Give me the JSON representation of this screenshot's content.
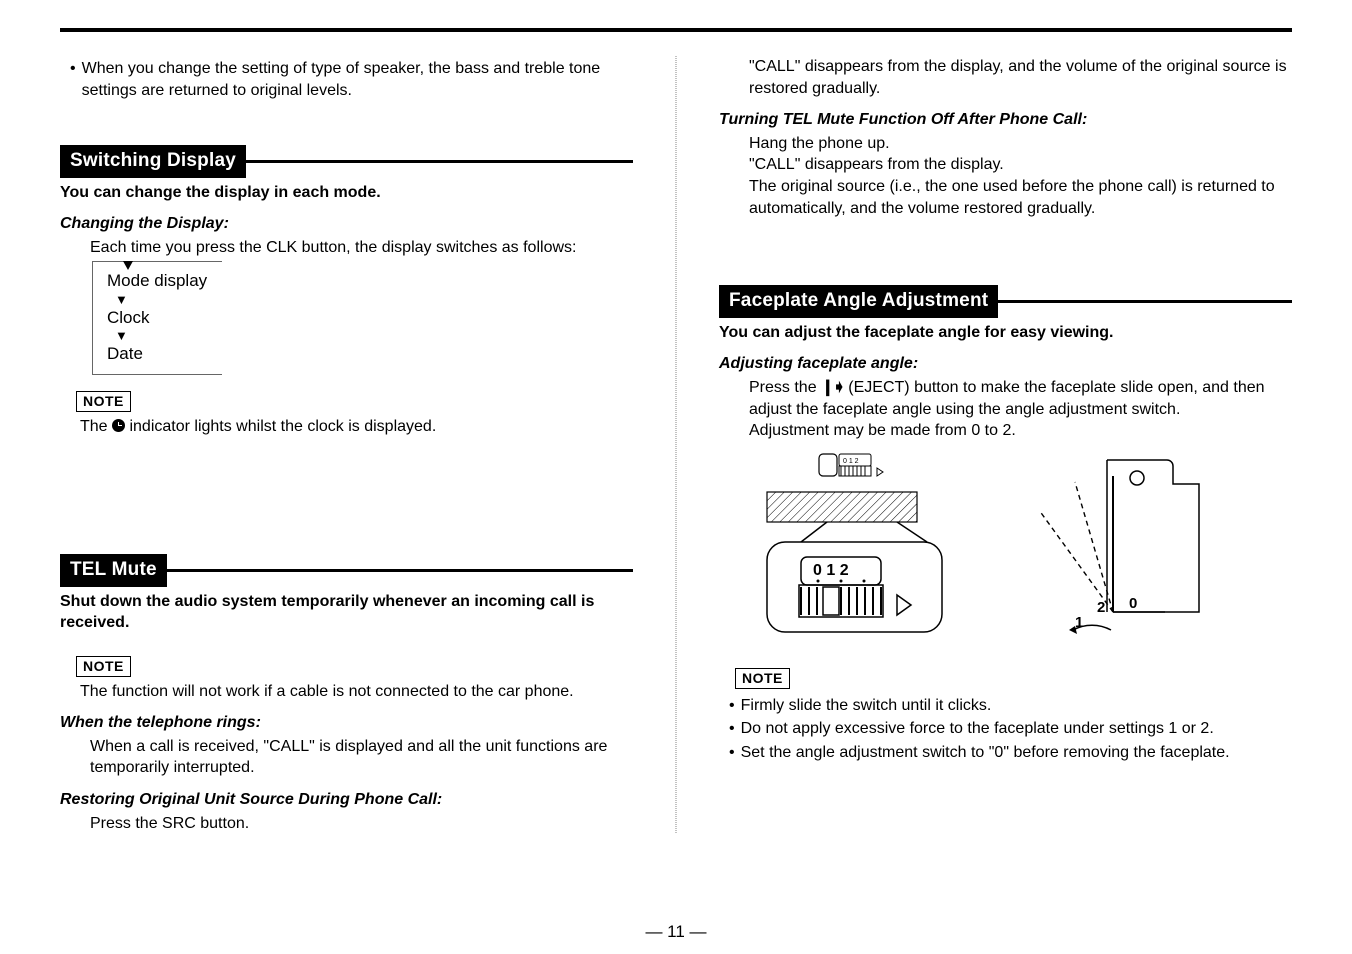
{
  "left": {
    "top_bullet": "When you change the setting of type of speaker, the bass and treble tone settings are returned to original levels.",
    "switching": {
      "title": "Switching Display",
      "lead": "You can change the display in each mode.",
      "sub1": "Changing the Display:",
      "sub1_body": "Each time you press the CLK button, the display switches as follows:",
      "flow": [
        "Mode display",
        "Clock",
        "Date"
      ],
      "note_label": "NOTE",
      "note_text_a": "The ",
      "note_text_b": " indicator lights whilst the clock is displayed."
    },
    "tel": {
      "title": "TEL Mute",
      "lead": "Shut down the audio system temporarily whenever an incoming call is received.",
      "note_label": "NOTE",
      "note_text": "The function will not work if a cable is not connected to the car phone.",
      "ring_sub": "When the telephone rings:",
      "ring_body": "When a call is received, \"CALL\" is displayed and all the unit functions are temporarily interrupted.",
      "restore_sub": "Restoring Original Unit Source During Phone Call:",
      "restore_body": "Press the SRC button."
    }
  },
  "right": {
    "cont1": "\"CALL\" disappears from the display, and the volume of the original source is restored gradually.",
    "turnoff_sub": "Turning TEL Mute Function Off After Phone Call:",
    "turnoff_body1": "Hang the phone up.",
    "turnoff_body2": "\"CALL\" disappears from the display.",
    "turnoff_body3": "The original source (i.e., the one used before the phone call) is returned to automatically, and the volume restored gradually.",
    "faceplate": {
      "title": "Faceplate Angle Adjustment",
      "lead": "You can adjust the faceplate angle for easy viewing.",
      "sub": "Adjusting faceplate angle:",
      "body_a": "Press the ",
      "eject_glyph": "❙➧",
      "body_b": " (EJECT) button to make the faceplate slide open, and then adjust the faceplate angle using the angle adjustment switch.",
      "body2": "Adjustment may be made from 0 to 2.",
      "note_label": "NOTE",
      "notes": [
        "Firmly slide the switch until it clicks.",
        "Do not apply excessive force to the faceplate under settings 1 or 2.",
        "Set the angle adjustment switch to \"0\" before removing the faceplate."
      ]
    }
  },
  "page_number": "— 11 —",
  "chart_data": {
    "type": "table",
    "title": "Faceplate angle settings",
    "positions": [
      0,
      1,
      2
    ]
  }
}
